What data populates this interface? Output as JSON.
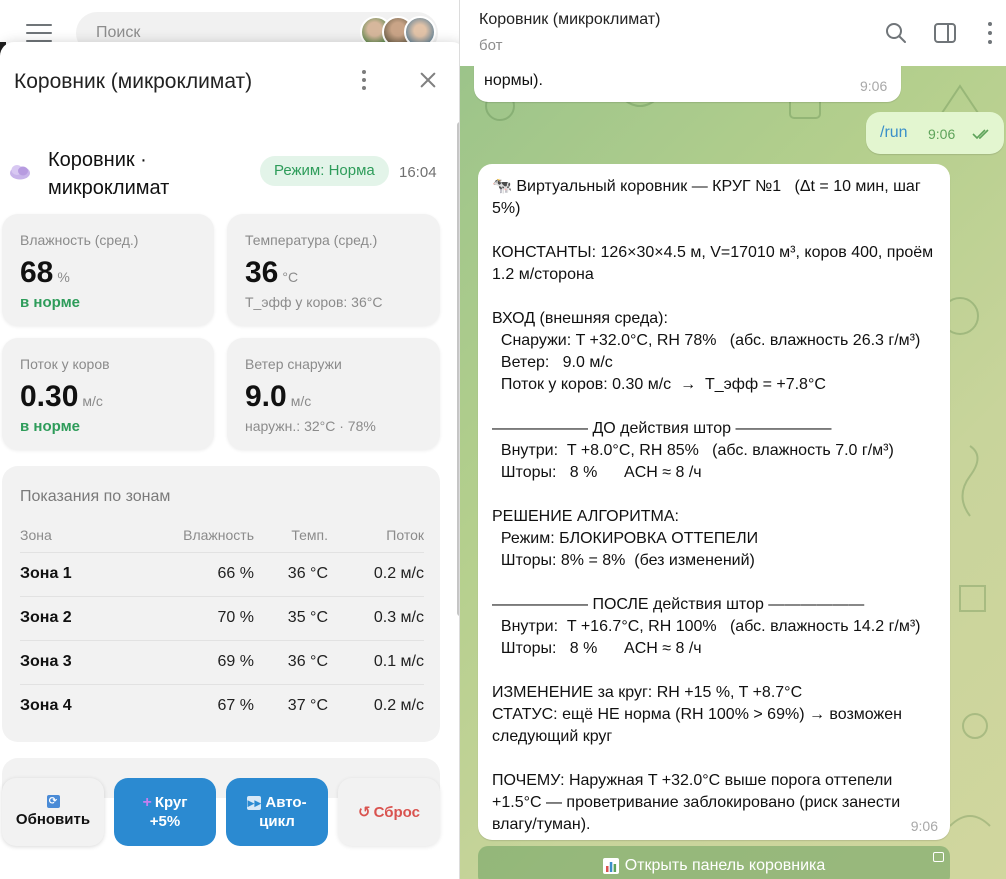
{
  "chat_list": {
    "search_placeholder": "Поиск"
  },
  "panel": {
    "title": "Коровник (микроклимат)",
    "app_title": "Коровник · микроклимат",
    "mode_badge": "Режим: Норма",
    "time": "16:04",
    "cards": {
      "humidity": {
        "label": "Влажность (сред.)",
        "value": "68",
        "unit": "%",
        "status": "в норме"
      },
      "temperature": {
        "label": "Температура (сред.)",
        "value": "36",
        "unit": "°C",
        "note": "T_эфф у коров: 36°C"
      },
      "flow": {
        "label": "Поток у коров",
        "value": "0.30",
        "unit": "м/с",
        "status": "в норме"
      },
      "wind": {
        "label": "Ветер снаружи",
        "value": "9.0",
        "unit": "м/с",
        "note": "наружн.: 32°C · 78%"
      }
    },
    "zones": {
      "title": "Показания по зонам",
      "headers": {
        "zone": "Зона",
        "humidity": "Влажность",
        "temp": "Темп.",
        "flow": "Поток"
      },
      "rows": [
        {
          "zone": "Зона 1",
          "humidity": "66 %",
          "temp": "36 °C",
          "flow": "0.2 м/с"
        },
        {
          "zone": "Зона 2",
          "humidity": "70 %",
          "temp": "35 °C",
          "flow": "0.3 м/с"
        },
        {
          "zone": "Зона 3",
          "humidity": "69 %",
          "temp": "36 °C",
          "flow": "0.1 м/с"
        },
        {
          "zone": "Зона 4",
          "humidity": "67 %",
          "temp": "37 °C",
          "flow": "0.2 м/с"
        }
      ]
    },
    "buttons": {
      "refresh": "Обновить",
      "cycle_line1": "Круг",
      "cycle_line2": "+5%",
      "auto_line1": "Авто-",
      "auto_line2": "цикл",
      "reset": "Сброс"
    },
    "colors": {
      "accent": "#2b8ad1",
      "ok": "#2e9c5a",
      "danger": "#d9534f"
    }
  },
  "chat": {
    "title": "Коровник (микроклимат)",
    "subtitle": "бот",
    "prev_message_tail": "нормы).",
    "prev_message_time": "9:06",
    "outgoing": {
      "text": "/run",
      "time": "9:06",
      "status": "read"
    },
    "bot_message": {
      "time": "9:06",
      "lines": [
        "🐄 Виртуальный коровник — КРУГ №1   (Δt = 10 мин, шаг 5%)",
        "",
        "КОНСТАНТЫ: 126×30×4.5 м, V=17010 м³, коров 400, проём 1.2 м/сторона",
        "",
        "ВХОД (внешняя среда):",
        "  Снаружи: T +32.0°C, RH 78%   (абс. влажность 26.3 г/м³)",
        "  Ветер:   9.0 м/с",
        "  Поток у коров: 0.30 м/с  →  T_эфф = +7.8°C",
        "",
        "—————— ДО действия штор ——————",
        "  Внутри:  T +8.0°C, RH 85%   (абс. влажность 7.0 г/м³)",
        "  Шторы:   8 %      ACH ≈ 8 /ч",
        "",
        "РЕШЕНИЕ АЛГОРИТМА:",
        "  Режим: БЛОКИРОВКА ОТТЕПЕЛИ",
        "  Шторы: 8% = 8%  (без изменений)",
        "",
        "—————— ПОСЛЕ действия штор ——————",
        "  Внутри:  T +16.7°C, RH 100%   (абс. влажность 14.2 г/м³)",
        "  Шторы:   8 %      ACH ≈ 8 /ч",
        "",
        "ИЗМЕНЕНИЕ за круг: RH +15 %, T +8.7°C",
        "СТАТУС: ещё НЕ норма (RH 100% > 69%) → возможен следующий круг",
        "",
        "ПОЧЕМУ: Наружная T +32.0°C выше порога оттепели +1.5°C — проветривание заблокировано (риск занести влагу/туман)."
      ]
    },
    "keyboard_button": "Открыть панель коровника"
  }
}
